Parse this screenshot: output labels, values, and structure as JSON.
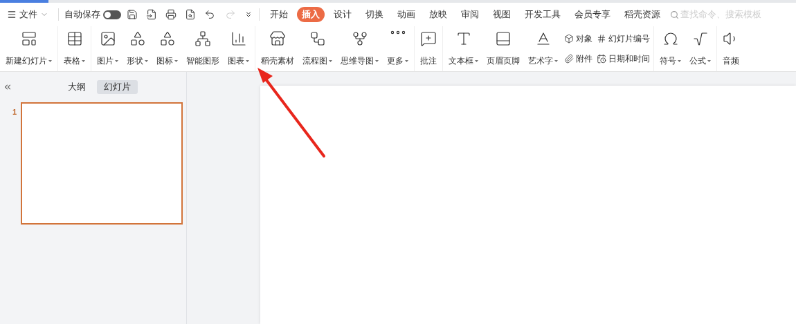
{
  "menu": {
    "file": "文件",
    "autosave": {
      "label": "自动保存",
      "on": false
    }
  },
  "tabs": [
    {
      "label": "开始",
      "selected": false
    },
    {
      "label": "插入",
      "selected": true
    },
    {
      "label": "设计",
      "selected": false
    },
    {
      "label": "切换",
      "selected": false
    },
    {
      "label": "动画",
      "selected": false
    },
    {
      "label": "放映",
      "selected": false
    },
    {
      "label": "审阅",
      "selected": false
    },
    {
      "label": "视图",
      "selected": false
    },
    {
      "label": "开发工具",
      "selected": false
    },
    {
      "label": "会员专享",
      "selected": false
    },
    {
      "label": "稻壳资源",
      "selected": false
    }
  ],
  "search": {
    "placeholder": "查找命令、搜索模板"
  },
  "ribbon_groups": [
    [
      {
        "kind": "big",
        "label": "新建幻灯片",
        "dropdown": true
      }
    ],
    [
      {
        "kind": "big",
        "label": "表格",
        "dropdown": true
      }
    ],
    [
      {
        "kind": "big",
        "label": "图片",
        "dropdown": true
      },
      {
        "kind": "big",
        "label": "形状",
        "dropdown": true
      },
      {
        "kind": "big",
        "label": "图标",
        "dropdown": true
      },
      {
        "kind": "big",
        "label": "智能图形",
        "dropdown": false
      },
      {
        "kind": "big",
        "label": "图表",
        "dropdown": true
      }
    ],
    [
      {
        "kind": "big",
        "label": "稻壳素材",
        "dropdown": false
      },
      {
        "kind": "big",
        "label": "流程图",
        "dropdown": true
      },
      {
        "kind": "big",
        "label": "思维导图",
        "dropdown": true
      },
      {
        "kind": "big",
        "label": "更多",
        "dropdown": true
      }
    ],
    [
      {
        "kind": "big",
        "label": "批注",
        "dropdown": false
      }
    ],
    [
      {
        "kind": "big",
        "label": "文本框",
        "dropdown": true
      },
      {
        "kind": "big",
        "label": "页眉页脚",
        "dropdown": false
      },
      {
        "kind": "big",
        "label": "艺术字",
        "dropdown": true
      },
      {
        "kind": "small",
        "top": "对象",
        "bottom": "附件"
      },
      {
        "kind": "small",
        "top": "幻灯片编号",
        "bottom": "日期和时间"
      }
    ],
    [
      {
        "kind": "big",
        "label": "符号",
        "dropdown": true
      },
      {
        "kind": "big",
        "label": "公式",
        "dropdown": true
      }
    ],
    [
      {
        "kind": "big",
        "label": "音频",
        "dropdown": false
      }
    ]
  ],
  "panel": {
    "tabs": [
      {
        "label": "大纲",
        "selected": false
      },
      {
        "label": "幻灯片",
        "selected": true
      }
    ],
    "slides": [
      {
        "number": "1",
        "selected": true
      }
    ]
  }
}
